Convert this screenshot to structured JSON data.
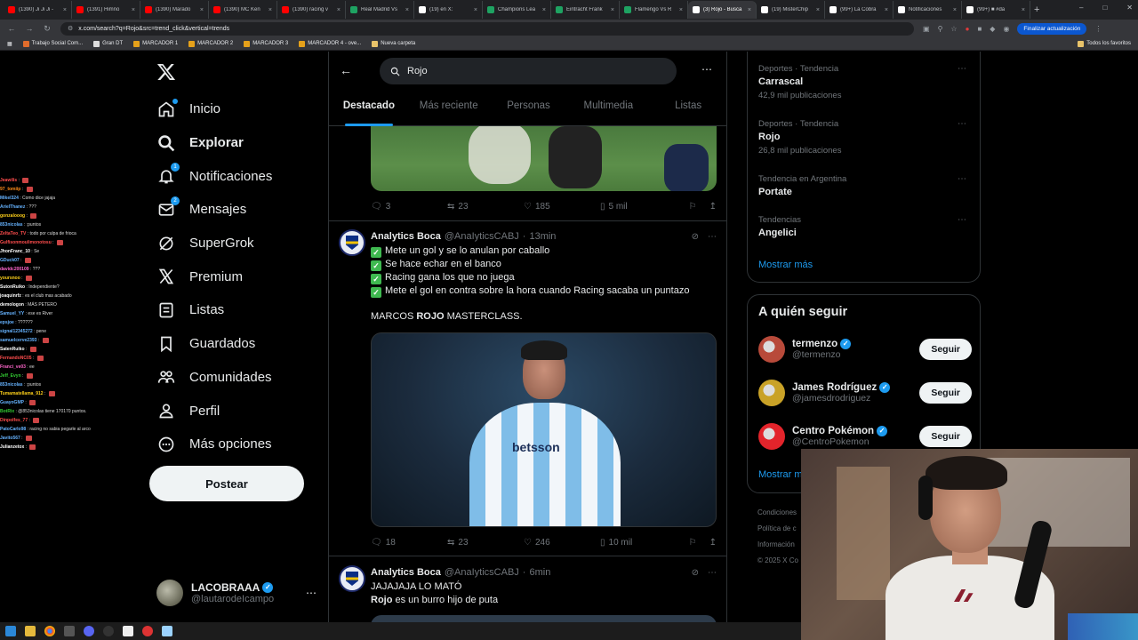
{
  "browser": {
    "tabs": [
      {
        "title": "(1390) Ji Ji Ji -",
        "color": "#ff0000",
        "active": false
      },
      {
        "title": "(1391) Himno",
        "color": "#ff0000",
        "active": false
      },
      {
        "title": "(1390) Marado",
        "color": "#ff0000",
        "active": false
      },
      {
        "title": "(1390) MC Ken",
        "color": "#ff0000",
        "active": false
      },
      {
        "title": "(1390) racing v",
        "color": "#ff0000",
        "active": false
      },
      {
        "title": "Real Madrid Vs",
        "color": "#1ea362",
        "active": false
      },
      {
        "title": "(19) en X:",
        "color": "#ffffff",
        "active": false
      },
      {
        "title": "Champions Lea",
        "color": "#1ea362",
        "active": false
      },
      {
        "title": "Eintracht Frank",
        "color": "#1ea362",
        "active": false
      },
      {
        "title": "Flamengo Vs R",
        "color": "#1ea362",
        "active": false
      },
      {
        "title": "(3) Rojo - Busca",
        "color": "#ffffff",
        "active": true
      },
      {
        "title": "(19) MisterChip",
        "color": "#ffffff",
        "active": false
      },
      {
        "title": "(99+) La Cobra",
        "color": "#ffffff",
        "active": false
      },
      {
        "title": "Notificaciones",
        "color": "#ffffff",
        "active": false
      },
      {
        "title": "(99+) ■ #da",
        "color": "#ffffff",
        "active": false
      }
    ],
    "url": "x.com/search?q=Rojo&src=trend_click&vertical=trends",
    "update_button": "Finalizar actualización",
    "bookmarks": [
      {
        "label": "Trabajo Social Com...",
        "color": "#e06c2c"
      },
      {
        "label": "Gran DT",
        "color": "#dddddd"
      },
      {
        "label": "MARCADOR 1",
        "color": "#e5a11a"
      },
      {
        "label": "MARCADOR 2",
        "color": "#e5a11a"
      },
      {
        "label": "MARCADOR 3",
        "color": "#e5a11a"
      },
      {
        "label": "MARCADOR 4 - ove...",
        "color": "#e5a11a"
      },
      {
        "label": "Nueva carpeta",
        "color": "#e8c36a"
      }
    ],
    "all_bookmarks": "Todos los favoritos"
  },
  "chat": [
    {
      "user": "Jeawilis",
      "msg": "",
      "color": "#ff4d4d",
      "emote": true
    },
    {
      "user": "97_tomiip",
      "msg": "",
      "color": "#ff8c1a",
      "emote": true
    },
    {
      "user": "Mikel324",
      "msg": "Como dice jajaja",
      "color": "#66b3ff",
      "emote": false
    },
    {
      "user": "ArielThanez",
      "msg": "???",
      "color": "#66b3ff",
      "emote": false
    },
    {
      "user": "gonzalooog",
      "msg": "",
      "color": "#ffd11a",
      "emote": true
    },
    {
      "user": "853nicolas",
      "msg": ":puntos",
      "color": "#66b3ff",
      "emote": false
    },
    {
      "user": "ZeltaTeo_TV",
      "msg": "todo por culpa de frioca",
      "color": "#ff4d4d",
      "emote": false
    },
    {
      "user": "Gulfisonmoulimonotosu",
      "msg": "",
      "color": "#ff4d4d",
      "emote": true
    },
    {
      "user": "JhonFranc_10",
      "msg": "Se",
      "color": "#ffffff",
      "emote": false
    },
    {
      "user": "GDuck07",
      "msg": "",
      "color": "#66b3ff",
      "emote": true
    },
    {
      "user": "davidc200109",
      "msg": "???",
      "color": "#ff66cc",
      "emote": false
    },
    {
      "user": "yoursnoo",
      "msg": "",
      "color": "#ffd11a",
      "emote": true
    },
    {
      "user": "SutonRuiko",
      "msg": "Independiente?",
      "color": "#ffffff",
      "emote": false
    },
    {
      "user": "joaquinrfz",
      "msg": "es el club mas acabado",
      "color": "#ffffff",
      "emote": false
    },
    {
      "user": "demologon",
      "msg": "MÁS PETERO",
      "color": "#ffffff",
      "emote": false
    },
    {
      "user": "Samuel_YY",
      "msg": "ese es River",
      "color": "#66b3ff",
      "emote": false
    },
    {
      "user": "epsjoe",
      "msg": "??????",
      "color": "#66b3ff",
      "emote": false
    },
    {
      "user": "signal12345272",
      "msg": "pene",
      "color": "#66b3ff",
      "emote": false
    },
    {
      "user": "samuelcerve2393",
      "msg": "",
      "color": "#66b3ff",
      "emote": true
    },
    {
      "user": "SatenRuiko",
      "msg": "",
      "color": "#ffffff",
      "emote": true
    },
    {
      "user": "FernandoNC05",
      "msg": "",
      "color": "#ff4d4d",
      "emote": true
    },
    {
      "user": "Franci_ve03",
      "msg": "ee",
      "color": "#ff66cc",
      "emote": false
    },
    {
      "user": "Jeff_Evyn",
      "msg": "",
      "color": "#33cc33",
      "emote": true
    },
    {
      "user": "853nicolas",
      "msg": ":puntos",
      "color": "#66b3ff",
      "emote": false
    },
    {
      "user": "Tumamatellama_912",
      "msg": "",
      "color": "#ffd11a",
      "emote": true
    },
    {
      "user": "GuayoGMP",
      "msg": "",
      "color": "#66b3ff",
      "emote": true
    },
    {
      "user": "BotRix",
      "msg": "@853nicolas tiene 170170 puntos.",
      "color": "#33cc33",
      "emote": false
    },
    {
      "user": "Dinpolfes_77",
      "msg": "",
      "color": "#ff4d4d",
      "emote": true
    },
    {
      "user": "PatoCarlo98",
      "msg": "racing no sabia pegarle al arco",
      "color": "#66b3ff",
      "emote": false
    },
    {
      "user": "Javito567",
      "msg": "",
      "color": "#66b3ff",
      "emote": true
    },
    {
      "user": "Julianzetox",
      "msg": "",
      "color": "#ffffff",
      "emote": true
    }
  ],
  "sidebar": {
    "items": [
      {
        "label": "Inicio",
        "icon": "home-icon",
        "bold": false,
        "badge": "dot"
      },
      {
        "label": "Explorar",
        "icon": "search-icon",
        "bold": true,
        "badge": ""
      },
      {
        "label": "Notificaciones",
        "icon": "bell-icon",
        "bold": false,
        "badge": "1"
      },
      {
        "label": "Mensajes",
        "icon": "mail-icon",
        "bold": false,
        "badge": "2"
      },
      {
        "label": "SuperGrok",
        "icon": "grok-icon",
        "bold": false,
        "badge": ""
      },
      {
        "label": "Premium",
        "icon": "x-premium-icon",
        "bold": false,
        "badge": ""
      },
      {
        "label": "Listas",
        "icon": "list-icon",
        "bold": false,
        "badge": ""
      },
      {
        "label": "Guardados",
        "icon": "bookmark-icon",
        "bold": false,
        "badge": ""
      },
      {
        "label": "Comunidades",
        "icon": "communities-icon",
        "bold": false,
        "badge": ""
      },
      {
        "label": "Perfil",
        "icon": "profile-icon",
        "bold": false,
        "badge": ""
      },
      {
        "label": "Más opciones",
        "icon": "more-options-icon",
        "bold": false,
        "badge": ""
      }
    ],
    "post_label": "Postear",
    "account": {
      "name": "LACOBRAAA",
      "handle": "@lautarodeIcampo"
    }
  },
  "search": {
    "query": "Rojo",
    "tabs": [
      {
        "label": "Destacado",
        "active": true
      },
      {
        "label": "Más reciente",
        "active": false
      },
      {
        "label": "Personas",
        "active": false
      },
      {
        "label": "Multimedia",
        "active": false
      },
      {
        "label": "Listas",
        "active": false
      }
    ]
  },
  "tweets": {
    "first_stats": {
      "replies": "3",
      "reposts": "23",
      "likes": "185",
      "views": "5 mil"
    },
    "second": {
      "name": "Analytics Boca",
      "handle": "@AnaIyticsCABJ",
      "time": "13min",
      "lines": [
        "Mete un gol y se lo anulan por caballo",
        "Se hace echar en el banco",
        "Racing gana los que no juega",
        "Mete el gol en contra sobre la hora cuando Racing sacaba un puntazo"
      ],
      "closing_pre": "MARCOS ",
      "closing_bold": "ROJO",
      "closing_post": " MASTERCLASS.",
      "sponsor": "betsson",
      "stats": {
        "replies": "18",
        "reposts": "23",
        "likes": "246",
        "views": "10 mil"
      }
    },
    "third": {
      "name": "Analytics Boca",
      "handle": "@AnaIyticsCABJ",
      "time": "6min",
      "line1": "JAJAJAJA LO MATÓ",
      "line2_bold": "Rojo",
      "line2_rest": " es un burro hijo de puta"
    }
  },
  "trends": [
    {
      "category": "Deportes · Tendencia",
      "term": "Carrascal",
      "count": "42,9 mil publicaciones"
    },
    {
      "category": "Deportes · Tendencia",
      "term": "Rojo",
      "count": "26,8 mil publicaciones"
    },
    {
      "category": "Tendencia en Argentina",
      "term": "Portate",
      "count": ""
    },
    {
      "category": "Tendencias",
      "term": "Angelici",
      "count": ""
    }
  ],
  "trends_more": "Mostrar más",
  "who_to_follow": {
    "title": "A quién seguir",
    "items": [
      {
        "name": "termenzo",
        "handle": "@termenzo",
        "avatar_color": "#b84a3a",
        "follow": "Seguir"
      },
      {
        "name": "James Rodríguez",
        "handle": "@jamesdrodriguez",
        "avatar_color": "#c9a227",
        "follow": "Seguir"
      },
      {
        "name": "Centro Pokémon",
        "handle": "@CentroPokemon",
        "avatar_color": "#e3242b",
        "follow": "Seguir"
      }
    ],
    "show_more": "Mostrar m"
  },
  "footer": [
    "Condiciones",
    "Política de c",
    "Información",
    "© 2025 X Co"
  ]
}
